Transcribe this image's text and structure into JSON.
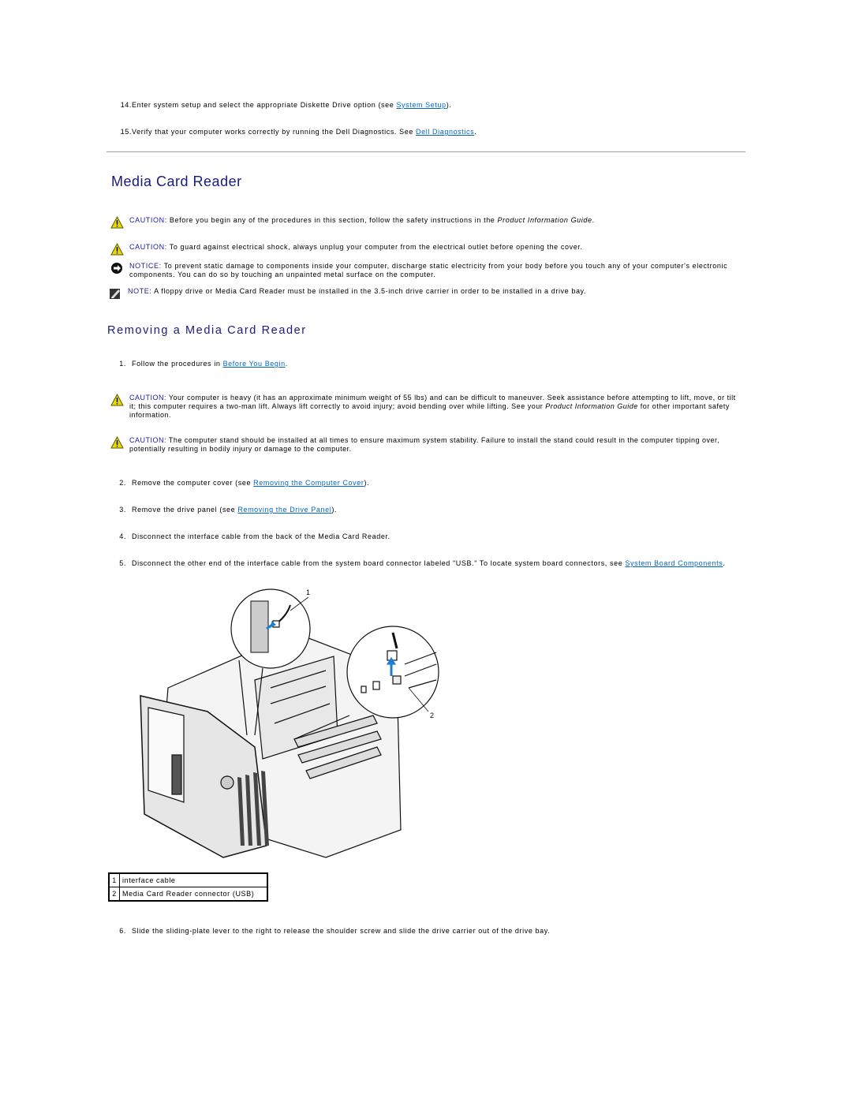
{
  "intro_steps": [
    {
      "num": "14.",
      "text_before": "Enter system setup and select the appropriate Diskette Drive option (see ",
      "link": "System Setup",
      "text_after": ")."
    },
    {
      "num": "15.",
      "text_before": "Verify that your computer works correctly by running the Dell Diagnostics. See ",
      "link": "Dell Diagnostics",
      "text_after": "."
    }
  ],
  "section_title": "Media Card Reader",
  "callouts": [
    {
      "icon": "caution-triangle-icon",
      "label": "CAUTION:",
      "text_before": " Before you begin any of the procedures in this section, follow the safety instructions in the ",
      "italic": "Product Information Guide",
      "text_after": "."
    },
    {
      "icon": "caution-triangle-icon",
      "label": "CAUTION:",
      "text": " To guard against electrical shock, always unplug your computer from the electrical outlet before opening the cover."
    },
    {
      "icon": "notice-icon",
      "label": "NOTICE:",
      "text": " To prevent static damage to components inside your computer, discharge static electricity from your body before you touch any of your computer's electronic components. You can do so by touching an unpainted metal surface on the computer."
    },
    {
      "icon": "note-pencil-icon",
      "label": "NOTE:",
      "text": " A floppy drive or Media Card Reader must be installed in the 3.5-inch drive carrier in order to be installed in a drive bay."
    }
  ],
  "subsection_title": "Removing a Media Card Reader",
  "step1": {
    "num": "1.",
    "text_before": "Follow the procedures in ",
    "link": "Before You Begin",
    "text_after": "."
  },
  "cautions2": [
    {
      "label": "CAUTION:",
      "text_before": " Your computer is heavy (it has an approximate minimum weight of 55 lbs) and can be difficult to maneuver. Seek assistance before attempting to lift, move, or tilt it; this computer requires a two-man lift. Always lift correctly to avoid injury; avoid bending over while lifting. See your ",
      "italic": "Product Information Guide",
      "text_after": " for other important safety information."
    },
    {
      "label": "CAUTION:",
      "text": " The computer stand should be installed at all times to ensure maximum system stability. Failure to install the stand could result in the computer tipping over, potentially resulting in bodily injury or damage to the computer."
    }
  ],
  "steps": [
    {
      "num": "2.",
      "text_before": "Remove the computer cover (see ",
      "link": "Removing the Computer Cover",
      "text_after": ")."
    },
    {
      "num": "3.",
      "text_before": "Remove the drive panel (see ",
      "link": "Removing the Drive Panel",
      "text_after": ")."
    },
    {
      "num": "4.",
      "text": "Disconnect the interface cable from the back of the Media Card Reader."
    },
    {
      "num": "5.",
      "text_before": "Disconnect the other end of the interface cable from the system board connector labeled \"USB.\" To locate system board connectors, see ",
      "link": "System Board Components",
      "text_after": "."
    }
  ],
  "figure": {
    "callout_labels": [
      "1",
      "2"
    ]
  },
  "legend": [
    {
      "num": "1",
      "desc": "interface cable"
    },
    {
      "num": "2",
      "desc": "Media Card Reader connector (USB)"
    }
  ],
  "step6": {
    "num": "6.",
    "text": "Slide the sliding-plate lever to the right to release the shoulder screw and slide the drive carrier out of the drive bay."
  },
  "colors": {
    "heading": "#1a1a7e",
    "link": "#0066cc",
    "caution_yellow": "#e8d800"
  }
}
